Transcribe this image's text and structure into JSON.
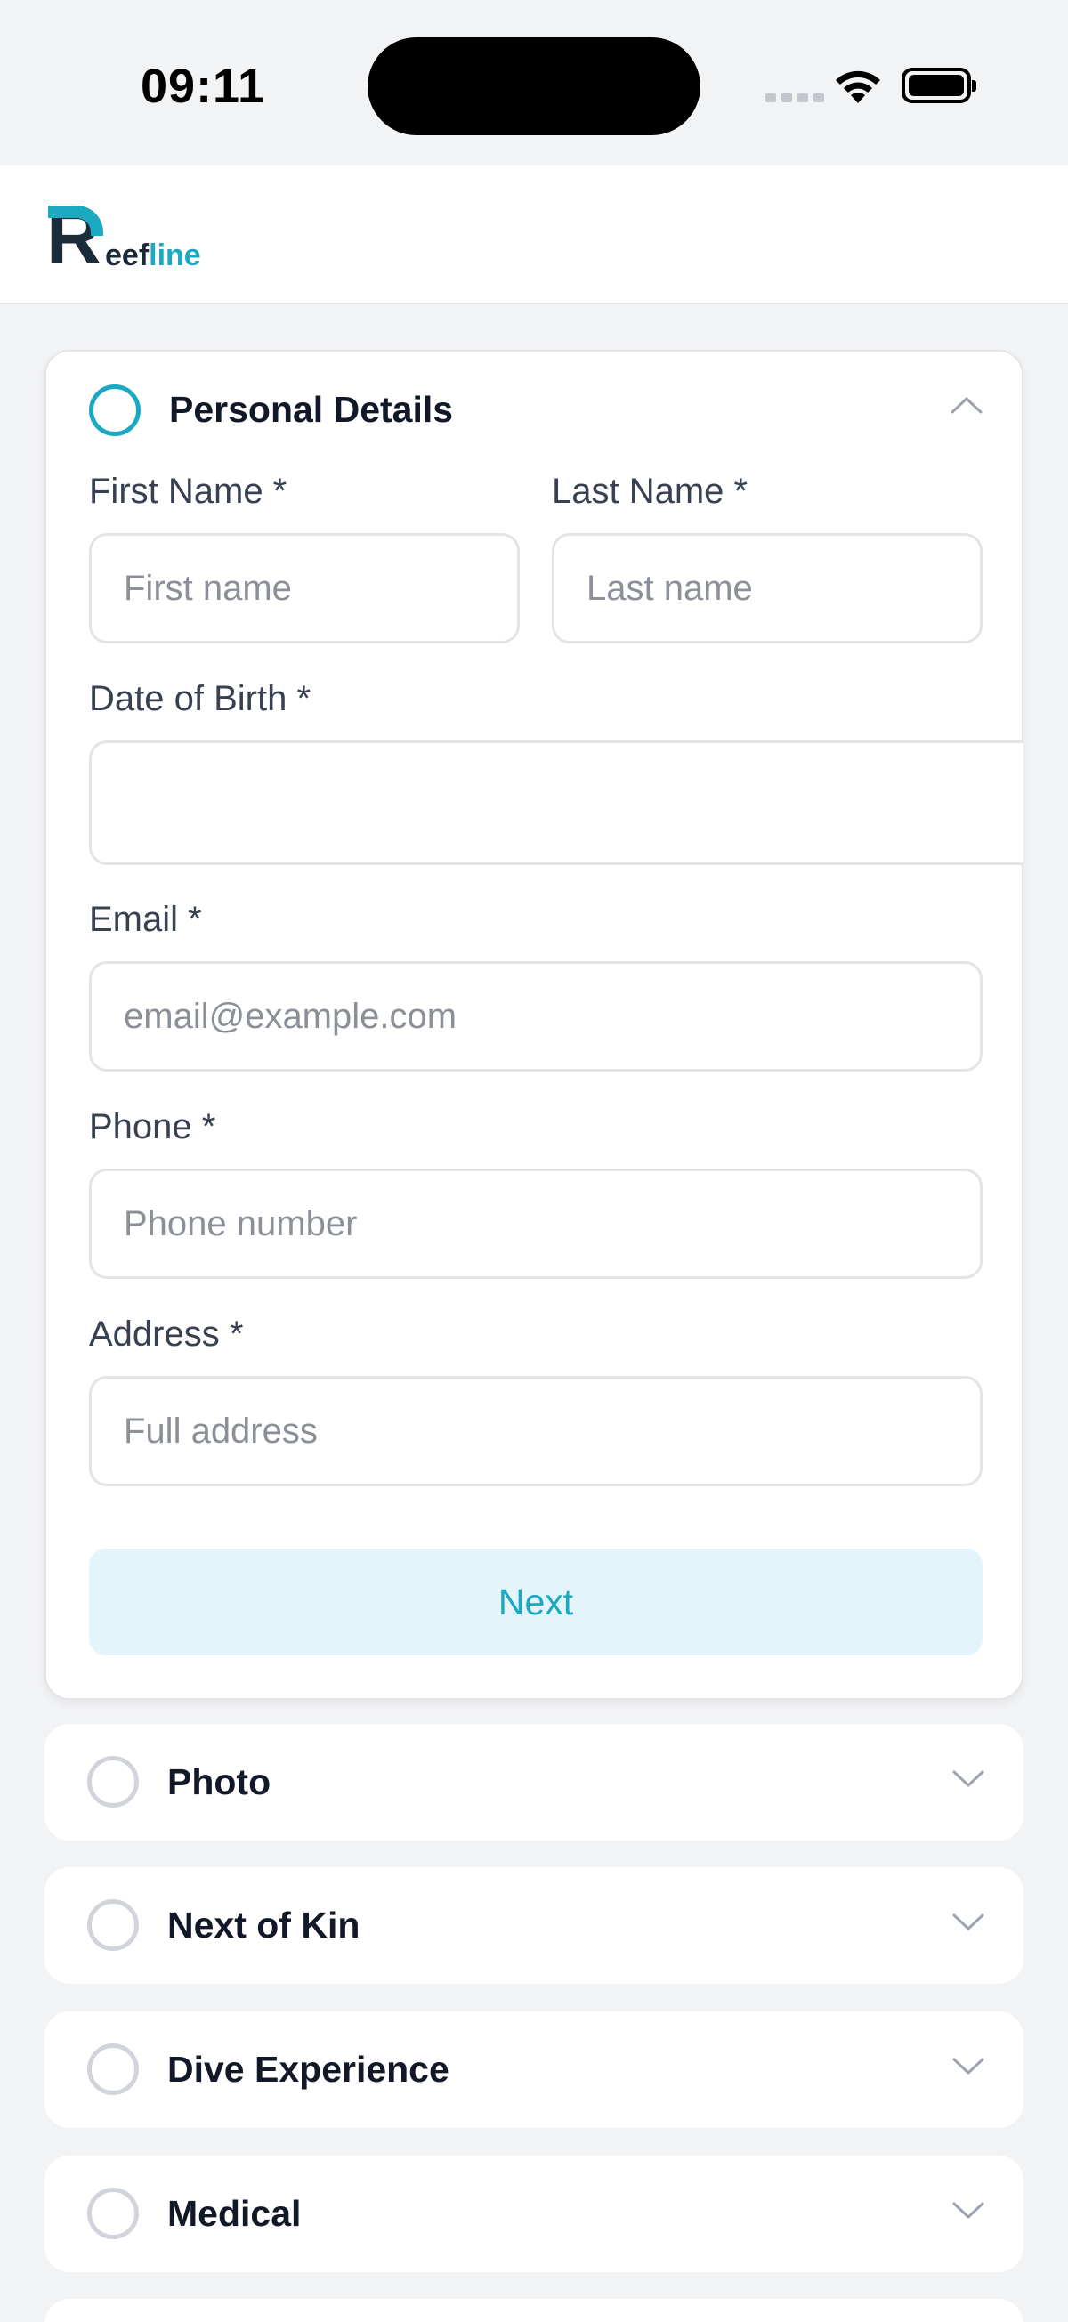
{
  "status_bar": {
    "time": "09:11"
  },
  "header": {
    "logo": {
      "mark": "R",
      "text_dark": "eef",
      "text_teal": "line"
    }
  },
  "sections": {
    "personal": {
      "title": "Personal Details",
      "first_name_label": "First Name *",
      "first_name_placeholder": "First name",
      "last_name_label": "Last Name *",
      "last_name_placeholder": "Last name",
      "dob_label": "Date of Birth *",
      "email_label": "Email *",
      "email_placeholder": "email@example.com",
      "phone_label": "Phone *",
      "phone_placeholder": "Phone number",
      "address_label": "Address *",
      "address_placeholder": "Full address",
      "next_label": "Next"
    },
    "photo": {
      "title": "Photo"
    },
    "kin": {
      "title": "Next of Kin"
    },
    "dive": {
      "title": "Dive Experience"
    },
    "medical": {
      "title": "Medical"
    }
  },
  "colors": {
    "accent": "#1aa9c0",
    "button_bg": "#e3f5fb",
    "page_bg": "#f2f3f5"
  }
}
